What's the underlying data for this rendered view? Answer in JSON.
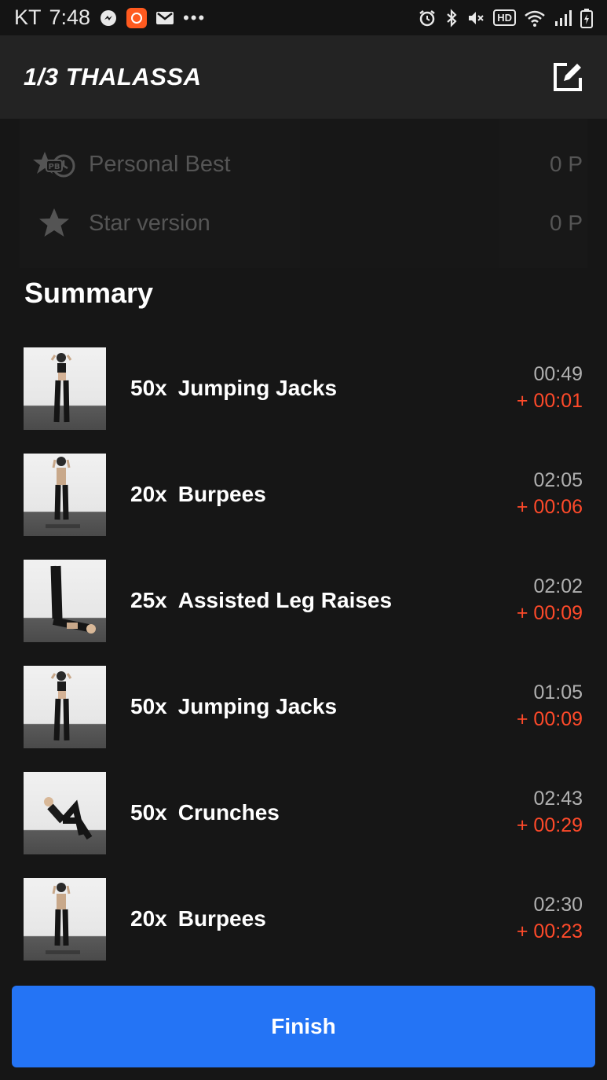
{
  "status_bar": {
    "carrier": "KT",
    "time": "7:48",
    "left_icons": [
      "messenger-icon",
      "app-orange-icon",
      "gmail-icon",
      "more-icon"
    ],
    "right_icons": [
      "alarm-icon",
      "bluetooth-icon",
      "mute-icon",
      "hd-icon",
      "wifi-icon",
      "signal-icon",
      "battery-icon"
    ],
    "hd_label": "HD"
  },
  "header": {
    "title": "1/3 THALASSA"
  },
  "scores": [
    {
      "label": "Personal Best",
      "points": "0 P",
      "icon": "personal-best-icon",
      "badge": "PB"
    },
    {
      "label": "Star version",
      "points": "0 P",
      "icon": "star-icon"
    }
  ],
  "summary": {
    "title": "Summary",
    "exercises": [
      {
        "reps": "50x",
        "name": "Jumping Jacks",
        "time": "00:49",
        "delta": "+ 00:01"
      },
      {
        "reps": "20x",
        "name": "Burpees",
        "time": "02:05",
        "delta": "+ 00:06"
      },
      {
        "reps": "25x",
        "name": "Assisted Leg Raises",
        "time": "02:02",
        "delta": "+ 00:09"
      },
      {
        "reps": "50x",
        "name": "Jumping Jacks",
        "time": "01:05",
        "delta": "+ 00:09"
      },
      {
        "reps": "50x",
        "name": "Crunches",
        "time": "02:43",
        "delta": "+ 00:29"
      },
      {
        "reps": "20x",
        "name": "Burpees",
        "time": "02:30",
        "delta": "+ 00:23"
      }
    ]
  },
  "finish_button": {
    "label": "Finish"
  },
  "colors": {
    "background": "#161616",
    "header": "#232323",
    "accent_blue": "#2474f5",
    "delta_red": "#ff4a2a"
  }
}
